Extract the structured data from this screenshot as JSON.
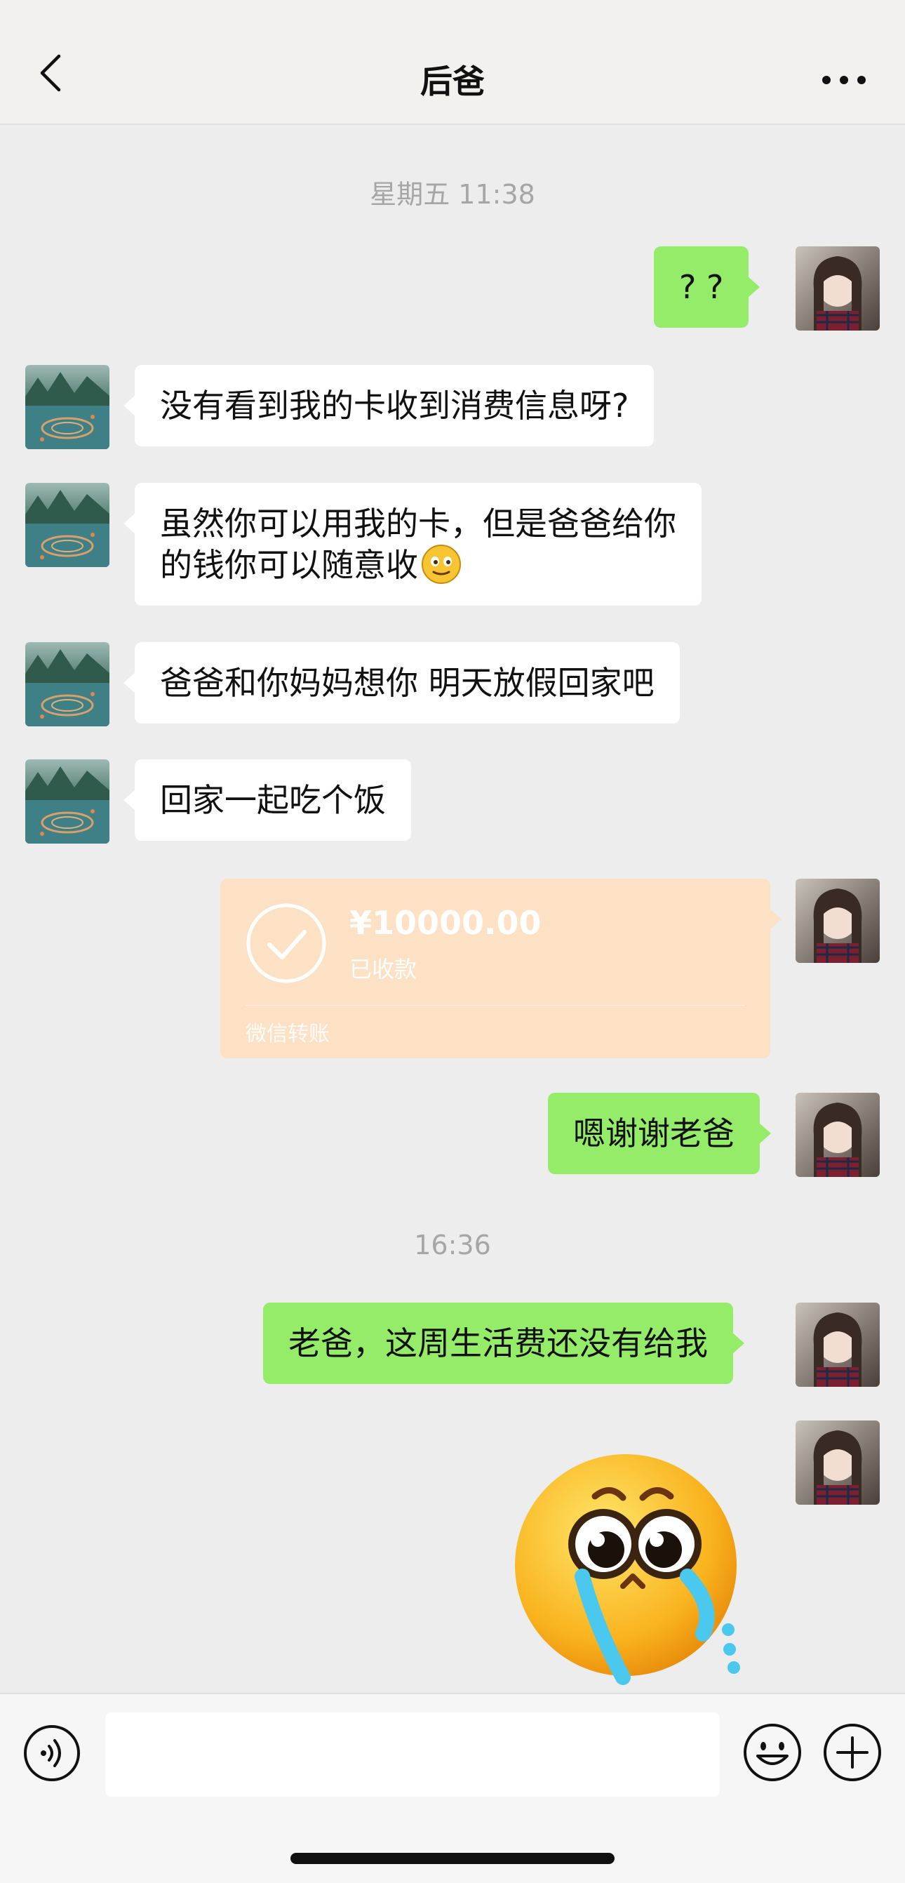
{
  "header": {
    "title": "后爸",
    "back_icon": "chevron-left-icon",
    "more_icon": "more-dots-icon"
  },
  "timestamps": {
    "first": "星期五 11:38",
    "second": "16:36"
  },
  "messages": [
    {
      "from": "me",
      "text": "? ?"
    },
    {
      "from": "dad",
      "text": "没有看到我的卡收到消费信息呀?"
    },
    {
      "from": "dad",
      "lines": [
        "虽然你可以用我的卡，但是爸爸给你",
        "的钱你可以随意收"
      ],
      "emoji": "smiling-face-icon"
    },
    {
      "from": "dad",
      "text": "爸爸和你妈妈想你 明天放假回家吧"
    },
    {
      "from": "dad",
      "text": "回家一起吃个饭"
    },
    {
      "from": "me",
      "type": "transfer"
    },
    {
      "from": "me",
      "text": "嗯谢谢老爸"
    },
    {
      "from": "me",
      "text": "老爸，这周生活费还没有给我"
    },
    {
      "from": "me",
      "type": "sticker",
      "sticker": "crying-pleading-face-icon"
    }
  ],
  "transfer": {
    "amount": "¥10000.00",
    "status": "已收款",
    "label": "微信转账"
  },
  "input_bar": {
    "voice_icon": "voice-icon",
    "input_value": "",
    "emoji_icon": "emoji-icon",
    "plus_icon": "plus-icon"
  },
  "colors": {
    "background": "#ededed",
    "my_bubble": "#95ec69",
    "their_bubble": "#ffffff",
    "transfer_card": "#fde1c4",
    "timestamp": "#a6a6a6"
  }
}
